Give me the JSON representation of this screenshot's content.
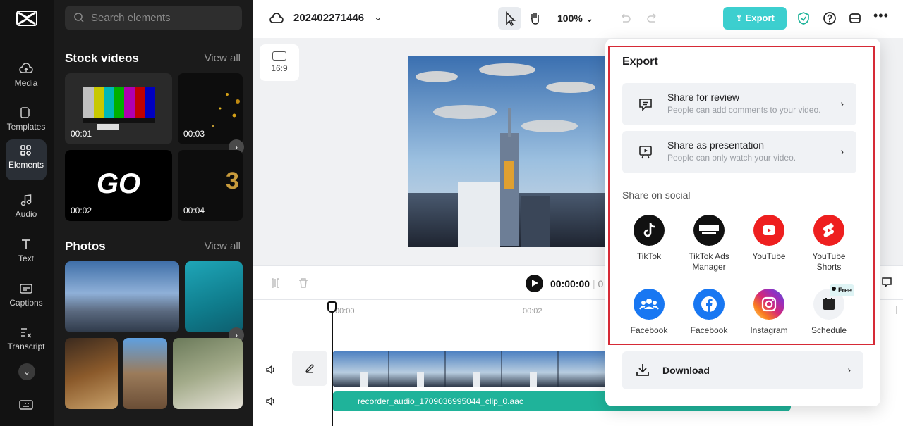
{
  "rail": {
    "items": [
      {
        "label": "Media"
      },
      {
        "label": "Templates"
      },
      {
        "label": "Elements"
      },
      {
        "label": "Audio"
      },
      {
        "label": "Text"
      },
      {
        "label": "Captions"
      },
      {
        "label": "Transcript"
      }
    ],
    "active": "Elements"
  },
  "panel": {
    "search_placeholder": "Search elements",
    "stock_videos": {
      "title": "Stock videos",
      "view_all": "View all",
      "items": [
        {
          "duration": "00:01"
        },
        {
          "duration": "00:03"
        },
        {
          "duration": "00:02",
          "text": "GO"
        },
        {
          "duration": "00:04"
        }
      ]
    },
    "photos": {
      "title": "Photos",
      "view_all": "View all"
    }
  },
  "topbar": {
    "project_name": "202402271446",
    "zoom": "100%",
    "export_label": "Export"
  },
  "canvas": {
    "ratio_label": "16:9"
  },
  "timeline": {
    "current_time": "00:00:00",
    "duration_partial": "0",
    "ruler": [
      "00:00",
      "00:02"
    ],
    "audio_clip_name": "recorder_audio_1709036995044_clip_0.aac"
  },
  "export_popup": {
    "title": "Export",
    "share_review": {
      "title": "Share for review",
      "subtitle": "People can add comments to your video."
    },
    "share_presentation": {
      "title": "Share as presentation",
      "subtitle": "People can only watch your video."
    },
    "social_heading": "Share on social",
    "social": [
      {
        "label": "TikTok",
        "color": "#111111"
      },
      {
        "label": "TikTok Ads Manager",
        "color": "#111111"
      },
      {
        "label": "YouTube",
        "color": "#ee1f1f"
      },
      {
        "label": "YouTube Shorts",
        "color": "#ee1f1f"
      },
      {
        "label": "Facebook",
        "color": "#1877f2"
      },
      {
        "label": "Facebook",
        "color": "#1877f2"
      },
      {
        "label": "Instagram",
        "color": "#d62976"
      },
      {
        "label": "Schedule",
        "color": "#f0f2f5"
      }
    ],
    "free_badge": "Free",
    "download_label": "Download"
  },
  "colors": {
    "accent": "#3ccfcf",
    "highlight_border": "#d62a36"
  }
}
